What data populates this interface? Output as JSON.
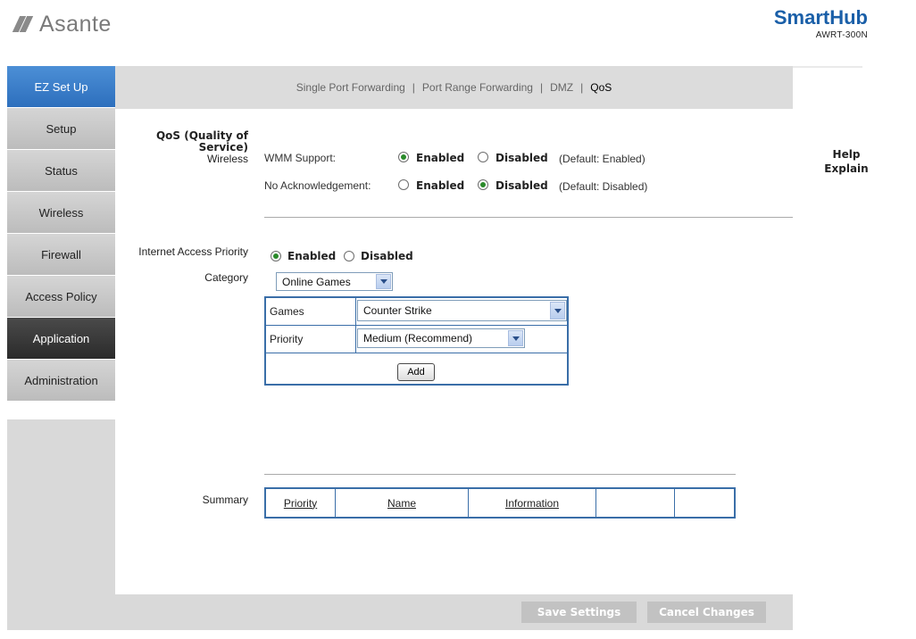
{
  "header": {
    "logo_text": "Asante",
    "brand_name": "SmartHub",
    "model": "AWRT-300N"
  },
  "sidebar": {
    "items": [
      {
        "label": "EZ Set Up"
      },
      {
        "label": "Setup"
      },
      {
        "label": "Status"
      },
      {
        "label": "Wireless"
      },
      {
        "label": "Firewall"
      },
      {
        "label": "Access Policy"
      },
      {
        "label": "Application"
      },
      {
        "label": "Administration"
      }
    ]
  },
  "submenu": {
    "items": [
      "Single Port Forwarding",
      "Port Range Forwarding",
      "DMZ",
      "QoS"
    ],
    "separator": "|",
    "current": "QoS"
  },
  "qos": {
    "section_title_line1": "QoS (Quality of",
    "section_title_line2": "Service)",
    "wireless_label": "Wireless",
    "wmm_label": "WMM Support:",
    "wmm_enabled_label": "Enabled",
    "wmm_disabled_label": "Disabled",
    "wmm_default": "(Default: Enabled)",
    "noack_label": "No Acknowledgement:",
    "noack_enabled_label": "Enabled",
    "noack_disabled_label": "Disabled",
    "noack_default": "(Default: Disabled)",
    "iap_label": "Internet Access Priority",
    "iap_enabled_label": "Enabled",
    "iap_disabled_label": "Disabled",
    "category_label": "Category",
    "category_value": "Online Games",
    "games_label": "Games",
    "games_value": "Counter Strike",
    "priority_label": "Priority",
    "priority_value": "Medium (Recommend)",
    "add_label": "Add",
    "summary_label": "Summary",
    "summary_columns": [
      "Priority",
      "Name",
      "Information"
    ]
  },
  "help": {
    "line1": "Help",
    "line2": "Explain"
  },
  "footer": {
    "save_label": "Save Settings",
    "cancel_label": "Cancel Changes"
  },
  "colors": {
    "accent_blue": "#2d6fbd",
    "active_nav": "#2b2b2b",
    "radio_selected": "#2a8a2a",
    "brand": "#1a5fa8"
  }
}
